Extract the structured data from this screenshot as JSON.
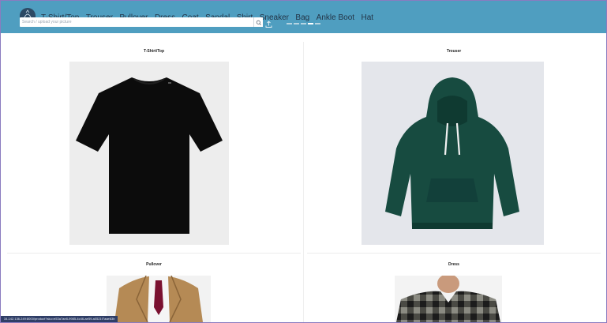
{
  "nav": {
    "items": [
      "T-Shirt/Top",
      "Trouser",
      "Pullover",
      "Dress",
      "Coat",
      "Sandal",
      "Shirt",
      "Sneaker",
      "Bag",
      "Ankle Boot",
      "Hat"
    ]
  },
  "search": {
    "placeholder": "Search / upload your picture"
  },
  "icons": {
    "logo": "logo-icon",
    "search": "search-icon",
    "upload": "upload-icon",
    "user": "user-icon"
  },
  "carousel": {
    "count": 5,
    "active_index": 3
  },
  "cards": [
    {
      "title": "T-Shirt/Top"
    },
    {
      "title": "Trouser"
    },
    {
      "title": "Pullover"
    },
    {
      "title": "Dress"
    }
  ],
  "status": {
    "url": "34.142.136.249:8000/product?sku=e53a7ae8-9985-4c46-ae59-a0521f7aae63b"
  },
  "colors": {
    "topbar": "#4f9ec0",
    "nav_text": "#233446",
    "status_bg": "#2f3e66",
    "frame_border": "#8a7bc0"
  }
}
